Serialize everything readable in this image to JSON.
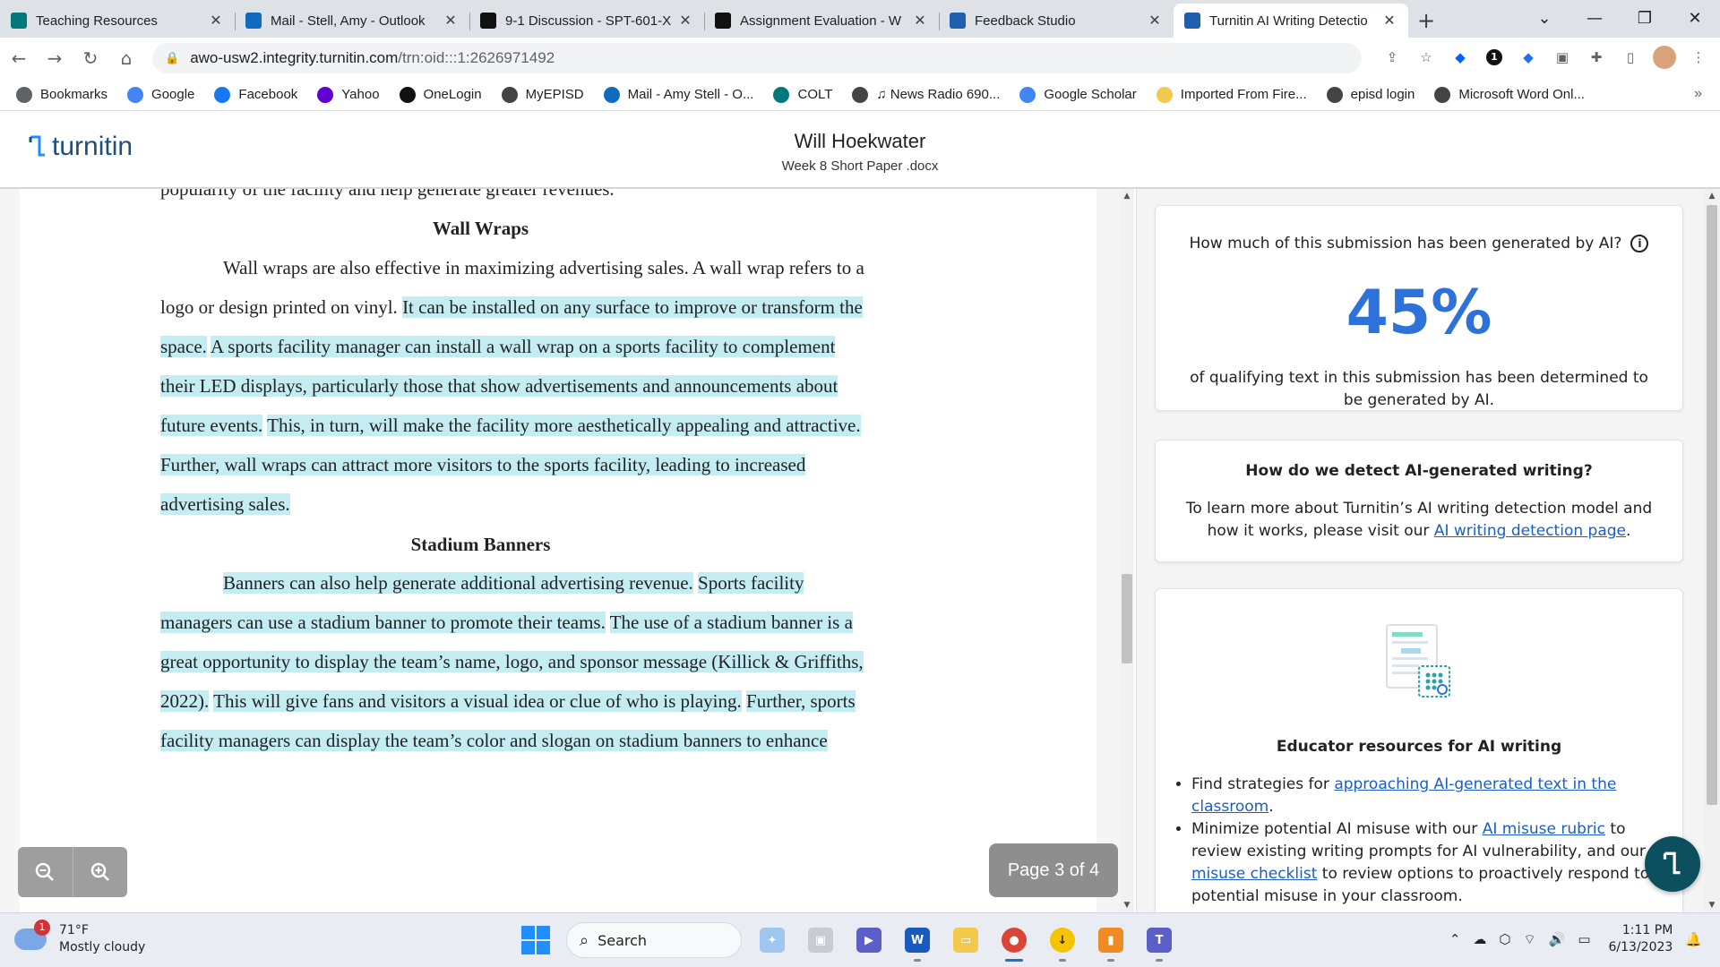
{
  "browser": {
    "tabs": [
      {
        "label": "Teaching Resources",
        "icon": "sharepoint-icon",
        "color": "#03787c"
      },
      {
        "label": "Mail - Stell, Amy - Outlook",
        "icon": "outlook-icon",
        "color": "#0f6cbd"
      },
      {
        "label": "9-1 Discussion - SPT-601-X",
        "icon": "d2l-icon",
        "color": "#111111"
      },
      {
        "label": "Assignment Evaluation - W",
        "icon": "d2l-icon",
        "color": "#111111"
      },
      {
        "label": "Feedback Studio",
        "icon": "turnitin-icon",
        "color": "#1f5fb0"
      },
      {
        "label": "Turnitin AI Writing Detectio",
        "icon": "turnitin-icon",
        "color": "#1f5fb0"
      }
    ],
    "url_host": "awo-usw2.integrity.turnitin.com",
    "url_path": "/trn:oid:::1:2626971492",
    "bookmarks": [
      {
        "label": "Bookmarks",
        "icon": "star-icon",
        "color": "#5f6368"
      },
      {
        "label": "Google",
        "icon": "google-icon",
        "color": "#4285f4"
      },
      {
        "label": "Facebook",
        "icon": "facebook-icon",
        "color": "#1877f2"
      },
      {
        "label": "Yahoo",
        "icon": "yahoo-icon",
        "color": "#6001d2"
      },
      {
        "label": "OneLogin",
        "icon": "onelogin-icon",
        "color": "#111111"
      },
      {
        "label": "MyEPISD",
        "icon": "globe-icon",
        "color": "#444444"
      },
      {
        "label": "Mail - Amy Stell - O...",
        "icon": "outlook-icon",
        "color": "#0f6cbd"
      },
      {
        "label": "COLT",
        "icon": "sharepoint-icon",
        "color": "#03787c"
      },
      {
        "label": "♫ News Radio 690...",
        "icon": "globe-icon",
        "color": "#444444"
      },
      {
        "label": "Google Scholar",
        "icon": "scholar-icon",
        "color": "#4285f4"
      },
      {
        "label": "Imported From Fire...",
        "icon": "folder-icon",
        "color": "#f2c94c"
      },
      {
        "label": "episd login",
        "icon": "globe-icon",
        "color": "#444444"
      },
      {
        "label": "Microsoft Word Onl...",
        "icon": "globe-icon",
        "color": "#444444"
      }
    ],
    "bookmarks_more": "»"
  },
  "header": {
    "logo_text": "turnitin",
    "student_name": "Will Hoekwater",
    "file_name": "Week 8 Short Paper .docx"
  },
  "document": {
    "lines": [
      {
        "segments": [
          {
            "text": "popularity of the facility and help generate greater revenues.",
            "hl": false
          }
        ]
      },
      {
        "segments": [
          {
            "text": "Wall Wraps",
            "hl": false
          }
        ],
        "heading": true
      },
      {
        "segments": [
          {
            "text": "Wall wraps are also effective in maximizing advertising sales. A wall wrap refers to a",
            "hl": false
          }
        ],
        "indent": true
      },
      {
        "segments": [
          {
            "text": "logo or design printed on vinyl. ",
            "hl": false
          },
          {
            "text": "It can be installed on any surface to improve or transform the",
            "hl": true
          }
        ]
      },
      {
        "segments": [
          {
            "text": "space.",
            "hl": true
          },
          {
            "text": " ",
            "hl": false
          },
          {
            "text": "A sports facility manager can install a wall wrap on a sports facility to complement",
            "hl": true
          }
        ]
      },
      {
        "segments": [
          {
            "text": "their LED displays, particularly those that show advertisements and announcements about",
            "hl": true
          }
        ]
      },
      {
        "segments": [
          {
            "text": "future events.",
            "hl": true
          },
          {
            "text": " ",
            "hl": false
          },
          {
            "text": "This, in turn, will make the facility more aesthetically appealing and attractive.",
            "hl": true
          }
        ]
      },
      {
        "segments": [
          {
            "text": "Further, wall wraps can attract more visitors to the sports facility, leading to increased",
            "hl": true
          }
        ]
      },
      {
        "segments": [
          {
            "text": "advertising sales.",
            "hl": true
          }
        ]
      },
      {
        "segments": [
          {
            "text": "Stadium Banners",
            "hl": false
          }
        ],
        "heading": true
      },
      {
        "segments": [
          {
            "text": "Banners can also help generate additional advertising revenue.",
            "hl": true
          },
          {
            "text": " ",
            "hl": false
          },
          {
            "text": "Sports facility",
            "hl": true
          }
        ],
        "indent": true
      },
      {
        "segments": [
          {
            "text": "managers can use a stadium banner to promote their teams.",
            "hl": true
          },
          {
            "text": " ",
            "hl": false
          },
          {
            "text": "The use of a stadium banner is a",
            "hl": true
          }
        ]
      },
      {
        "segments": [
          {
            "text": "great opportunity to display the team’s name, logo, and sponsor message (Killick & Griffiths,",
            "hl": true
          }
        ]
      },
      {
        "segments": [
          {
            "text": "2022).",
            "hl": true
          },
          {
            "text": " ",
            "hl": false
          },
          {
            "text": "This will give fans and visitors a visual idea or clue of who is playing.",
            "hl": true
          },
          {
            "text": " ",
            "hl": false
          },
          {
            "text": "Further, sports",
            "hl": true
          }
        ]
      },
      {
        "segments": [
          {
            "text": "facility managers can display the team’s color and slogan on stadium banners to enhance",
            "hl": true
          }
        ]
      }
    ],
    "page_indicator": "Page 3 of 4"
  },
  "ai_panel": {
    "question": "How much of this submission has been generated by AI?",
    "percent": "45%",
    "percent_description": "of qualifying text in this submission has been determined to be generated by AI.",
    "detect_title": "How do we detect AI-generated writing?",
    "detect_text_before": "To learn more about Turnitin’s AI writing detection model and how it works, please visit our ",
    "detect_link": "AI writing detection page",
    "detect_text_after": ".",
    "resources_title": "Educator resources for AI writing",
    "bullet1_before": "Find strategies for ",
    "bullet1_link": "approaching AI-generated text in the classroom",
    "bullet1_after": ".",
    "bullet2_before": "Minimize potential AI misuse with our ",
    "bullet2_link1": "AI misuse rubric",
    "bullet2_mid": " to review existing writing prompts for AI vulnerability, and our ",
    "bullet2_link2": "AI misuse checklist",
    "bullet2_after": " to review options to proactively respond to potential misuse in your classroom."
  },
  "taskbar": {
    "weather_temp": "71°F",
    "weather_desc": "Mostly cloudy",
    "weather_badge": "1",
    "search_label": "Search",
    "time": "1:11 PM",
    "date": "6/13/2023"
  },
  "colors": {
    "highlight": "#c4ecf3",
    "accent_blue": "#2c72d8",
    "link": "#1a5ec7",
    "fab": "#0c4f5f"
  }
}
